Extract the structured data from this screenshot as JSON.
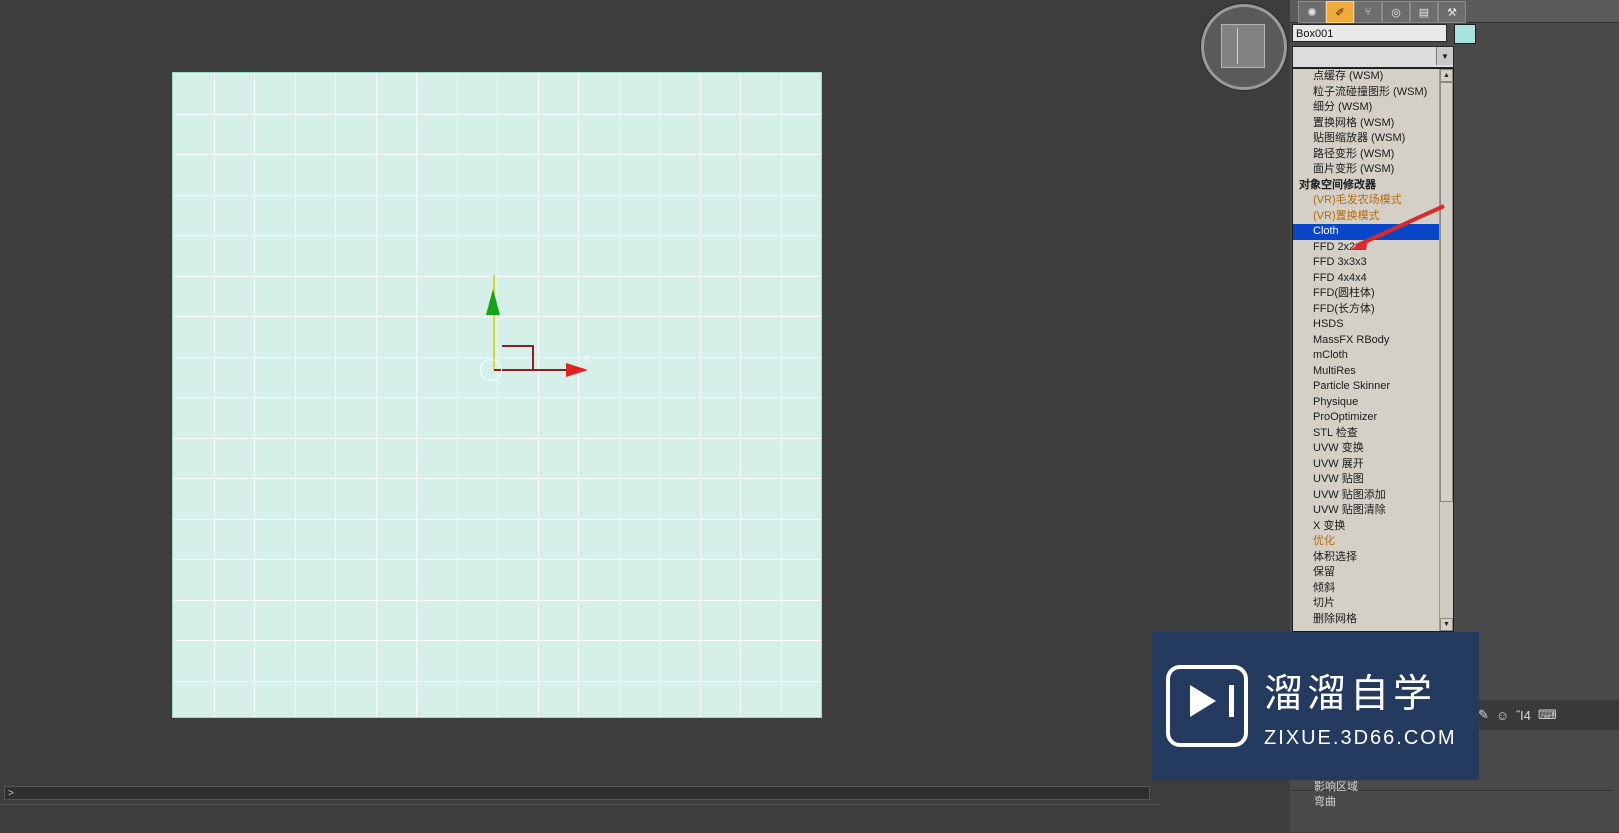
{
  "viewport": {
    "axis_label_x": "X",
    "gizmo_name": "transform-gizmo"
  },
  "command_panel": {
    "tool_icons": [
      {
        "name": "create-tab",
        "glyph": "✺"
      },
      {
        "name": "modify-tab",
        "glyph": "✐"
      },
      {
        "name": "hierarchy-tab",
        "glyph": "⑂"
      },
      {
        "name": "motion-tab",
        "glyph": "◎"
      },
      {
        "name": "display-tab",
        "glyph": "▤"
      },
      {
        "name": "utilities-tab",
        "glyph": "⚒"
      }
    ],
    "object_name": "Box001",
    "object_color": "#a8e3dd",
    "modifier_combo_value": "",
    "modifier_combo_arrow": "▼",
    "modifier_list": [
      {
        "label": "点缓存 (WSM)",
        "state": "normal"
      },
      {
        "label": "粒子流碰撞图形 (WSM)",
        "state": "normal"
      },
      {
        "label": "细分 (WSM)",
        "state": "normal"
      },
      {
        "label": "置换网格 (WSM)",
        "state": "normal"
      },
      {
        "label": "贴图缩放器 (WSM)",
        "state": "normal"
      },
      {
        "label": "路径变形 (WSM)",
        "state": "normal"
      },
      {
        "label": "面片变形 (WSM)",
        "state": "normal"
      },
      {
        "label": "对象空间修改器",
        "state": "header"
      },
      {
        "label": "(VR)毛发农场模式",
        "state": "orange"
      },
      {
        "label": "(VR)置换模式",
        "state": "orange"
      },
      {
        "label": "Cloth",
        "state": "selected"
      },
      {
        "label": "FFD 2x2x2",
        "state": "normal"
      },
      {
        "label": "FFD 3x3x3",
        "state": "normal"
      },
      {
        "label": "FFD 4x4x4",
        "state": "normal"
      },
      {
        "label": "FFD(圆柱体)",
        "state": "normal"
      },
      {
        "label": "FFD(长方体)",
        "state": "normal"
      },
      {
        "label": "HSDS",
        "state": "normal"
      },
      {
        "label": "MassFX RBody",
        "state": "normal"
      },
      {
        "label": "mCloth",
        "state": "normal"
      },
      {
        "label": "MultiRes",
        "state": "normal"
      },
      {
        "label": "Particle Skinner",
        "state": "normal"
      },
      {
        "label": "Physique",
        "state": "normal"
      },
      {
        "label": "ProOptimizer",
        "state": "normal"
      },
      {
        "label": "STL 检查",
        "state": "normal"
      },
      {
        "label": "UVW 变换",
        "state": "normal"
      },
      {
        "label": "UVW 展开",
        "state": "normal"
      },
      {
        "label": "UVW 贴图",
        "state": "normal"
      },
      {
        "label": "UVW 贴图添加",
        "state": "normal"
      },
      {
        "label": "UVW 贴图清除",
        "state": "normal"
      },
      {
        "label": "X 变换",
        "state": "normal"
      },
      {
        "label": "优化",
        "state": "orange"
      },
      {
        "label": "体积选择",
        "state": "normal"
      },
      {
        "label": "保留",
        "state": "normal"
      },
      {
        "label": "倾斜",
        "state": "normal"
      },
      {
        "label": "切片",
        "state": "normal"
      },
      {
        "label": "删除网格",
        "state": "normal"
      }
    ],
    "scroll_up_glyph": "▲",
    "scroll_down_glyph": "▼",
    "below_items": [
      "影响区域",
      "弯曲"
    ]
  },
  "status": {
    "prompt_text": ">"
  },
  "taskbar": {
    "items": [
      {
        "name": "pencil-icon",
        "glyph": "✎"
      },
      {
        "name": "emoji-icon",
        "glyph": "☺"
      },
      {
        "name": "microphone-icon",
        "glyph": "Ἲ4"
      },
      {
        "name": "keyboard-icon",
        "glyph": "⌨"
      }
    ]
  },
  "watermark": {
    "title": "溜溜自学",
    "subtitle": "ZIXUE.3D66.COM"
  }
}
